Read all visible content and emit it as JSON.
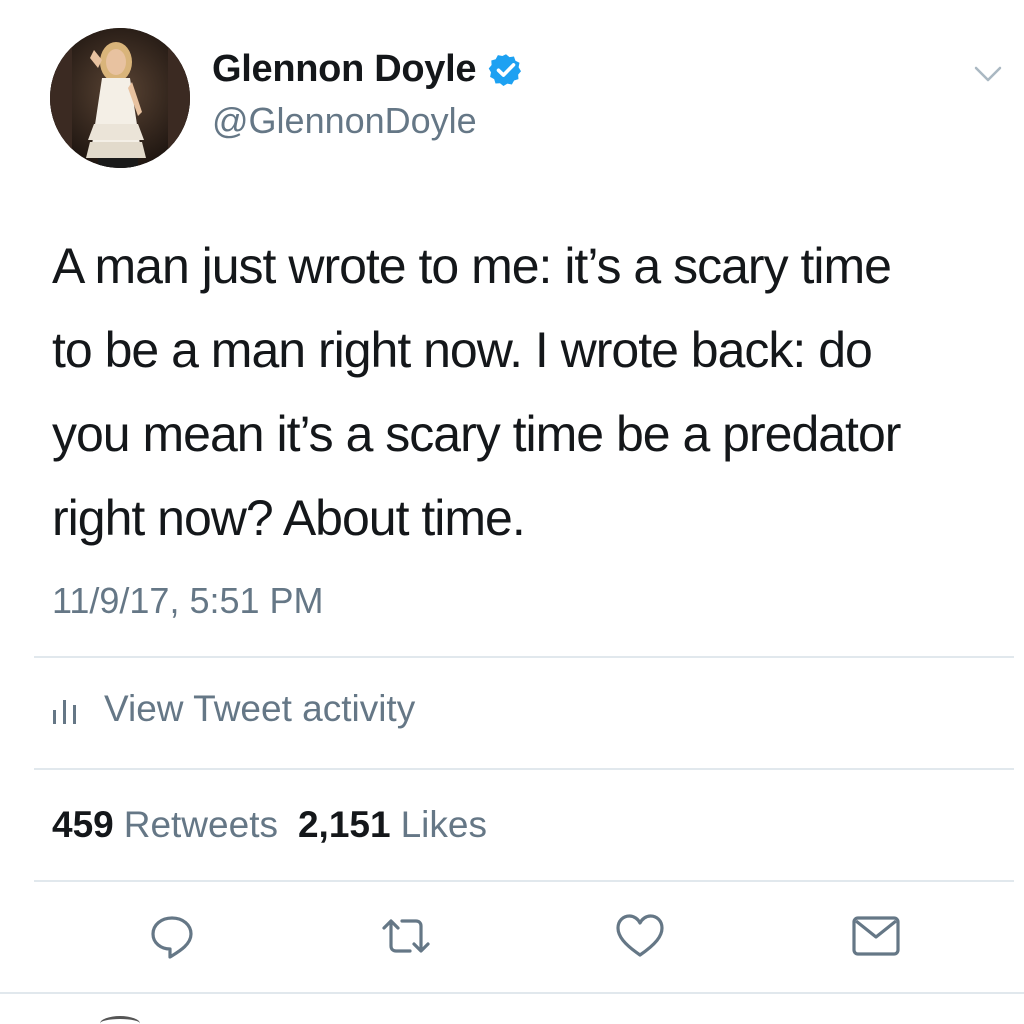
{
  "user": {
    "display_name": "Glennon Doyle",
    "handle": "@GlennonDoyle",
    "verified": true,
    "avatar_icon": "profile-photo"
  },
  "tweet": {
    "text": "A man just wrote to me: it’s a scary time\nto be a man right now. I wrote back: do\nyou mean it’s a scary time be a predator\nright now? About time.",
    "timestamp": "11/9/17, 5:51 PM"
  },
  "activity": {
    "label": "View Tweet activity",
    "icon": "bar-chart-icon"
  },
  "stats": {
    "retweets_count": "459",
    "retweets_label": "Retweets",
    "likes_count": "2,151",
    "likes_label": "Likes"
  },
  "actions": [
    {
      "icon": "reply-icon"
    },
    {
      "icon": "retweet-icon"
    },
    {
      "icon": "like-icon"
    },
    {
      "icon": "direct-message-icon"
    }
  ],
  "colors": {
    "primary_text": "#14171a",
    "secondary_text": "#657786",
    "verified_blue": "#1da1f2",
    "divider": "#e1e8ed"
  }
}
